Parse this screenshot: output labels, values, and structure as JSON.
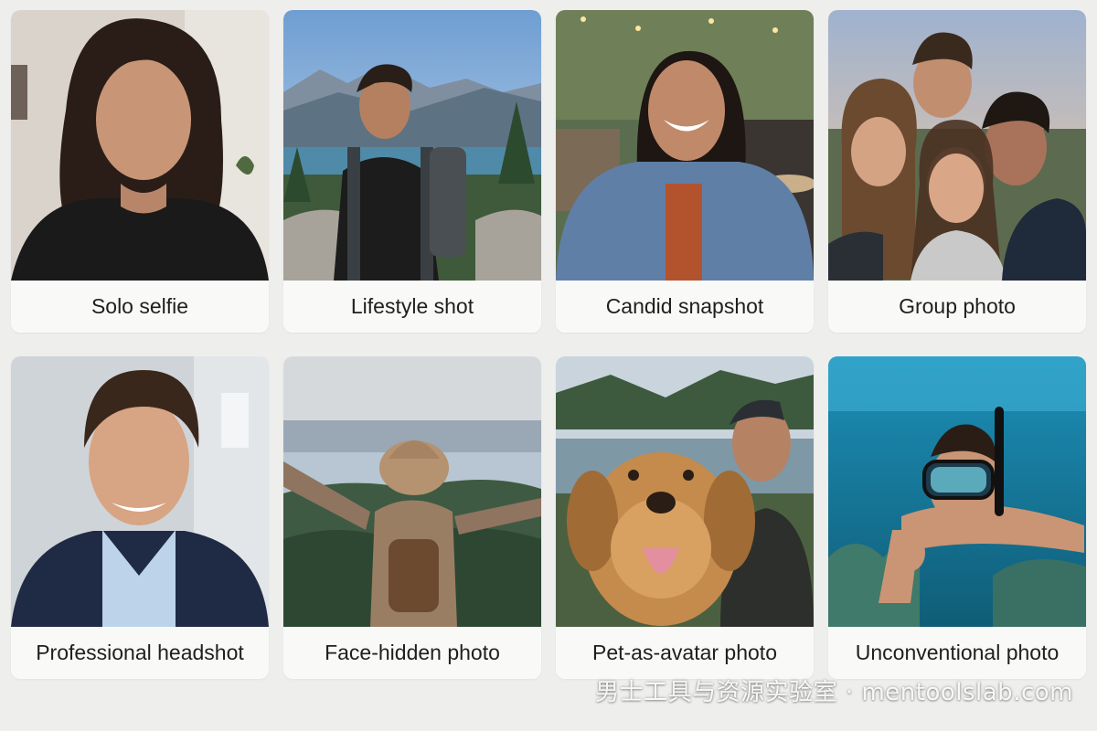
{
  "cards": [
    {
      "label": "Solo selfie"
    },
    {
      "label": "Lifestyle shot"
    },
    {
      "label": "Candid snapshot"
    },
    {
      "label": "Group photo"
    },
    {
      "label": "Professional headshot"
    },
    {
      "label": "Face-hidden photo"
    },
    {
      "label": "Pet-as-avatar photo"
    },
    {
      "label": "Unconventional photo"
    }
  ],
  "watermark": "男士工具与资源实验室 · mentoolslab.com"
}
